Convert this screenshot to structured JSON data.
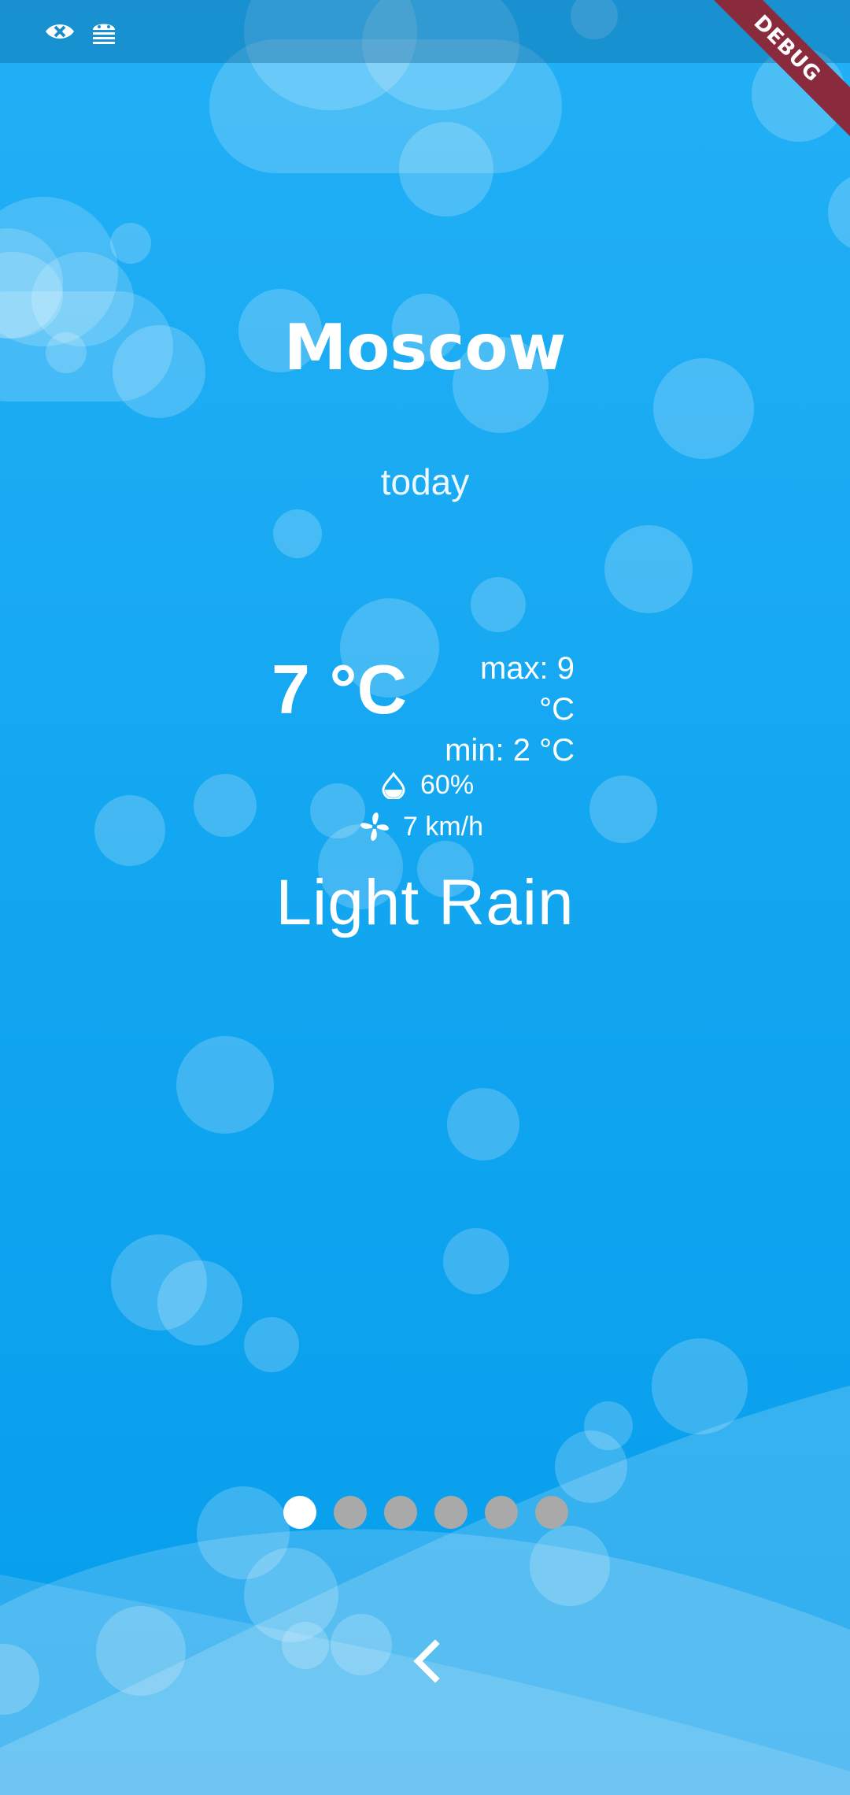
{
  "debug_banner": "DEBUG",
  "status_icons": [
    "no-signal-icon",
    "android-debug-icon"
  ],
  "weather": {
    "city": "Moscow",
    "day": "today",
    "temperature": "7 °C",
    "max": "max: 9 °C",
    "min": "min: 2 °C",
    "humidity": "60%",
    "wind": "7 km/h",
    "condition": "Light Rain"
  },
  "pager": {
    "pages": 6,
    "active_index": 0
  },
  "icons": {
    "humidity": "water-drop-icon",
    "wind": "fan-icon",
    "back": "chevron-left-icon"
  },
  "colors": {
    "sky_top": "#22b0f6",
    "sky_bottom": "#059dec",
    "dot_active": "#ffffff",
    "dot_inactive": "#a9a9a9",
    "debug": "#8a2b3d"
  }
}
